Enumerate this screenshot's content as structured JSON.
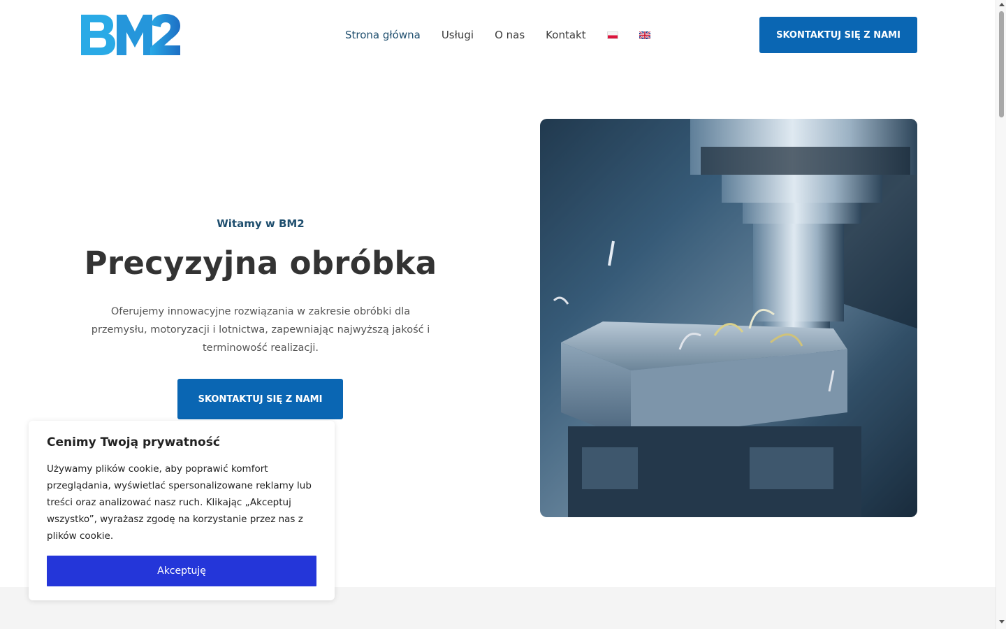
{
  "header": {
    "logo_text": "BM2",
    "nav": [
      {
        "label": "Strona główna",
        "active": true
      },
      {
        "label": "Usługi"
      },
      {
        "label": "O nas"
      },
      {
        "label": "Kontakt"
      }
    ],
    "languages": [
      {
        "code": "pl",
        "icon": "flag-pl-icon"
      },
      {
        "code": "en",
        "icon": "flag-gb-icon"
      }
    ],
    "contact_button": "SKONTAKTUJ SIĘ Z NAMI"
  },
  "hero": {
    "subtitle": "Witamy w BM2",
    "title": "Precyzyjna obróbka",
    "description": "Oferujemy innowacyjne rozwiązania w zakresie obróbki dla przemysłu, motoryzacji i lotnictwa, zapewniając najwyższą jakość i terminowość realizacji.",
    "button": "SKONTAKTUJ SIĘ Z NAMI",
    "image": "cnc-milling-machine-photo"
  },
  "cookie": {
    "title": "Cenimy Twoją prywatność",
    "text": "Używamy plików cookie, aby poprawić komfort przeglądania, wyświetlać spersonalizowane reklamy lub treści oraz analizować nasz ruch. Klikając „Akceptuj wszystko”, wyrażasz zgodę na korzystanie przez nas z plików cookie.",
    "accept_button": "Akceptuję"
  },
  "colors": {
    "primary_button": "#0a66b3",
    "cookie_button": "#2436d9",
    "accent_text": "#1e4e6e"
  }
}
